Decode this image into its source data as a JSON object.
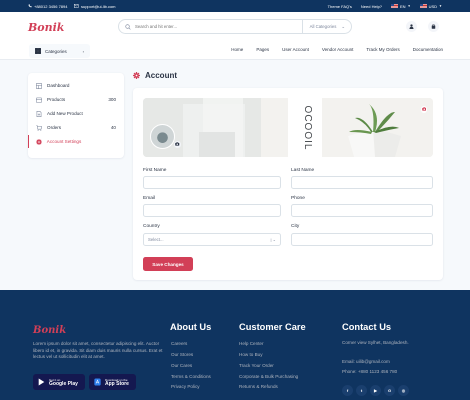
{
  "topbar": {
    "phone": "+88012 3456 7894",
    "email": "support@ui-lib.com",
    "faq": "Theme FAQ's",
    "help": "Need Help?",
    "language": "EN",
    "currency": "USD"
  },
  "header": {
    "logo": "Bonik",
    "search_placeholder": "Search and hit enter...",
    "search_category": "All Categories"
  },
  "nav": {
    "categories_label": "Categories",
    "links": [
      "Home",
      "Pages",
      "User Account",
      "Vendor Account",
      "Track My Orders",
      "Documentation"
    ]
  },
  "sidebar": {
    "items": [
      {
        "label": "Dashboard",
        "count": ""
      },
      {
        "label": "Products",
        "count": "300"
      },
      {
        "label": "Add New Product",
        "count": ""
      },
      {
        "label": "Orders",
        "count": "40"
      },
      {
        "label": "Account Settings",
        "count": ""
      }
    ]
  },
  "account": {
    "title": "Account",
    "fields": {
      "first_name": {
        "label": "First Name",
        "value": ""
      },
      "last_name": {
        "label": "Last Name",
        "value": ""
      },
      "email": {
        "label": "Email",
        "value": ""
      },
      "phone": {
        "label": "Phone",
        "value": ""
      },
      "country": {
        "label": "Country",
        "placeholder": "Select..."
      },
      "city": {
        "label": "City",
        "value": ""
      }
    },
    "save_button": "Save Changes",
    "banner_text": "OCOOIL"
  },
  "footer": {
    "logo": "Bonik",
    "about_text": "Lorem ipsum dolor sit amet, consectetur adipiscing elit. Auctor libero id et, in gravida. Sit diam duis mauris nulla cursus. Erat et lectus vel ut sollicitudin elit at amet.",
    "google_play": {
      "small": "Get it on",
      "big": "Google Play"
    },
    "app_store": {
      "small": "Download on the",
      "big": "App Store"
    },
    "about_us": {
      "title": "About Us",
      "links": [
        "Careers",
        "Our Stores",
        "Our Cares",
        "Terms & Conditions",
        "Privacy Policy"
      ]
    },
    "customer_care": {
      "title": "Customer Care",
      "links": [
        "Help Center",
        "How to Buy",
        "Track Your Order",
        "Corporate & Bulk Purchasing",
        "Returns & Refunds"
      ]
    },
    "contact": {
      "title": "Contact Us",
      "address": "Corner view Sylhet, Bangladesh.",
      "email": "Email: uilib@gmail.com",
      "phone": "Phone: +880 1123 456 780"
    },
    "social_icons": [
      "facebook-icon",
      "twitter-icon",
      "youtube-icon",
      "google-icon",
      "instagram-icon"
    ]
  },
  "colors": {
    "brand": "#d23f57",
    "navy": "#0f3460"
  }
}
